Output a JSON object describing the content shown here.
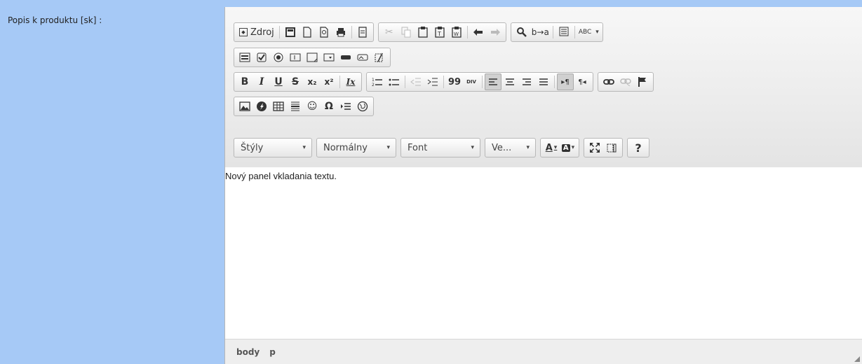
{
  "field": {
    "label": "Popis k produktu [sk] :"
  },
  "toolbar": {
    "row1": {
      "source_label": "Zdroj",
      "source_icon": "source-icon",
      "find_label": "Q",
      "spell_label": "ABC",
      "spell_icon": "spellcheck-icon"
    },
    "row3": {
      "bold": "B",
      "italic": "I",
      "underline": "U",
      "strike": "S",
      "subscript": "x₂",
      "superscript": "x²",
      "remove_format": "Ix",
      "blockquote": "99",
      "div": "DIV",
      "ltr": "▸¶",
      "rtl": "¶◂"
    },
    "row4": {
      "smiley": "☺",
      "special_char": "Ω"
    },
    "row5": {
      "styles_label": "Štýly",
      "format_label": "Normálny",
      "font_label": "Font",
      "size_label": "Ve...",
      "text_color_label": "A",
      "bg_color_label": "A",
      "help_label": "?"
    }
  },
  "content": {
    "text": "Nový panel vkladania textu."
  },
  "status": {
    "path": [
      "body",
      "p"
    ]
  },
  "colors": {
    "page_bg": "#a6c9f6",
    "toolbar_bg": "#eaeaea"
  }
}
